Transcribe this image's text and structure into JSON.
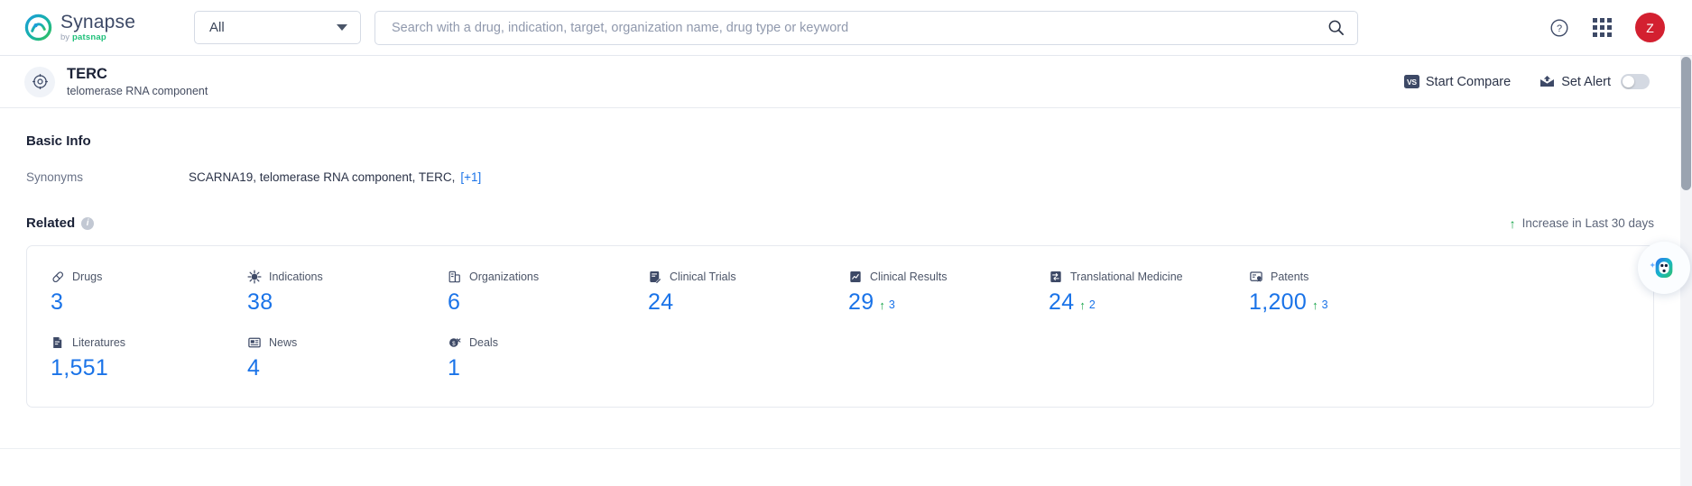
{
  "header": {
    "logo_name": "Synapse",
    "logo_sub_prefix": "by",
    "logo_sub_brand": "patsnap",
    "scope_value": "All",
    "scope_caret_icon": "chevron-down-icon",
    "search_placeholder": "Search with a drug, indication, target, organization name, drug type or keyword",
    "search_value": "",
    "search_icon": "search-icon",
    "help_icon": "question-circle-icon",
    "apps_icon": "grid-apps-icon",
    "avatar_initial": "Z"
  },
  "title_bar": {
    "entity_icon": "target-icon",
    "entity_name": "TERC",
    "entity_description": "telomerase RNA component",
    "compare_badge": "VS",
    "compare_label": "Start Compare",
    "alert_icon": "alert-envelope-icon",
    "alert_label": "Set Alert",
    "alert_toggle_state": "off"
  },
  "basic_info": {
    "section_title": "Basic Info",
    "synonyms_label": "Synonyms",
    "synonyms_value": "SCARNA19,  telomerase RNA component,  TERC,",
    "synonyms_more": "[+1]"
  },
  "related": {
    "title": "Related",
    "info_icon": "info-icon",
    "legend_arrow": "↑",
    "legend_text": "Increase in Last 30 days",
    "row1": [
      {
        "icon": "pill-icon",
        "label": "Drugs",
        "value": "3",
        "delta": ""
      },
      {
        "icon": "virus-icon",
        "label": "Indications",
        "value": "38",
        "delta": ""
      },
      {
        "icon": "organization-icon",
        "label": "Organizations",
        "value": "6",
        "delta": ""
      },
      {
        "icon": "clinical-trial-icon",
        "label": "Clinical Trials",
        "value": "24",
        "delta": ""
      },
      {
        "icon": "clinical-result-icon",
        "label": "Clinical Results",
        "value": "29",
        "delta": "3"
      },
      {
        "icon": "translational-icon",
        "label": "Translational Medicine",
        "value": "24",
        "delta": "2"
      },
      {
        "icon": "patent-icon",
        "label": "Patents",
        "value": "1,200",
        "delta": "3"
      }
    ],
    "row2": [
      {
        "icon": "literature-icon",
        "label": "Literatures",
        "value": "1,551",
        "delta": ""
      },
      {
        "icon": "news-icon",
        "label": "News",
        "value": "4",
        "delta": ""
      },
      {
        "icon": "deal-icon",
        "label": "Deals",
        "value": "1",
        "delta": ""
      }
    ]
  },
  "assistant": {
    "icon": "ai-assistant-icon"
  },
  "colors": {
    "accent_blue": "#1a73e8",
    "increase_green": "#19a54a",
    "avatar_red": "#d32030",
    "text_dark": "#1b2237"
  }
}
